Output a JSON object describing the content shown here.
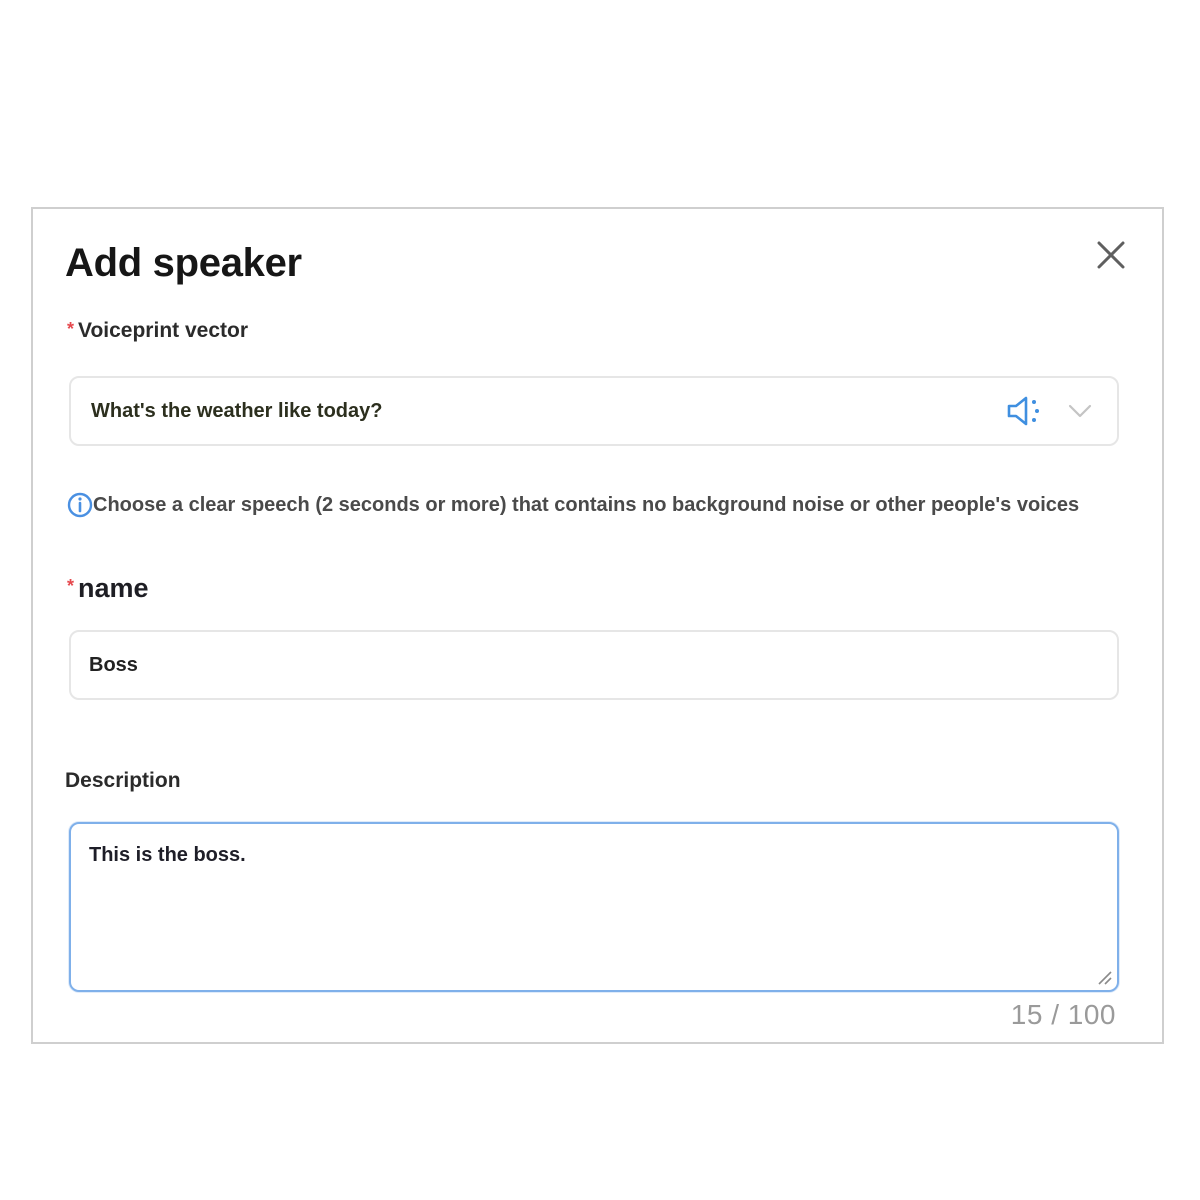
{
  "dialog": {
    "title": "Add speaker",
    "close_icon": "close-icon"
  },
  "voiceprint": {
    "required_marker": "*",
    "label": "Voiceprint vector",
    "selected_value": "What's the weather like today?",
    "play_icon": "speaker-icon",
    "dropdown_icon": "chevron-down-icon",
    "hint_icon": "info-icon",
    "hint": "Choose a clear speech (2 seconds or more) that contains no background noise or other people's voices"
  },
  "name_field": {
    "required_marker": "*",
    "label": "name",
    "value": "Boss"
  },
  "description_field": {
    "label": "Description",
    "value": "This is the boss.",
    "counter": "15 / 100"
  },
  "colors": {
    "accent": "#4a90e2",
    "required": "#e5484d",
    "focus_border": "#7fb0ea"
  }
}
